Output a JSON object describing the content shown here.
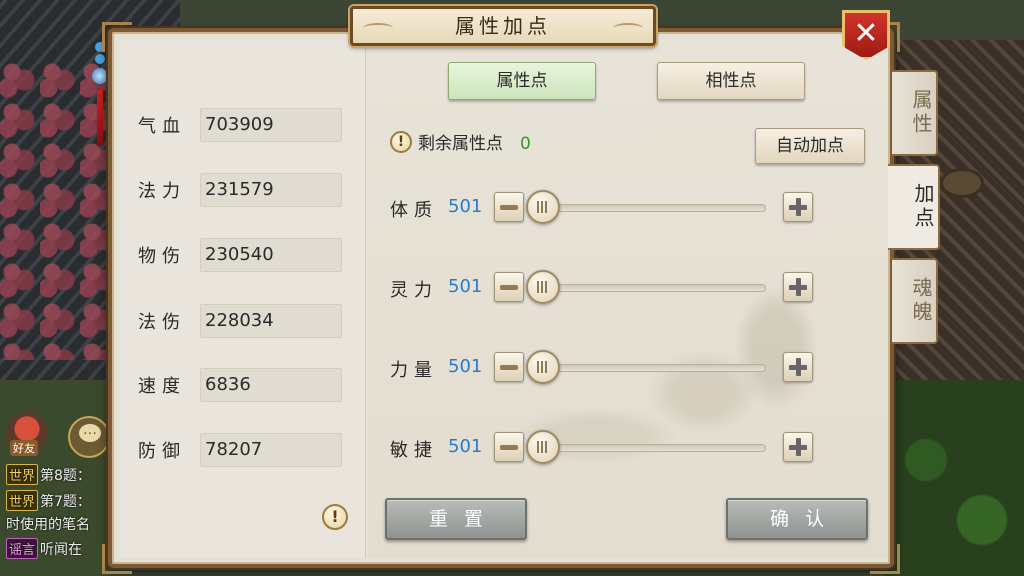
{
  "title": "属性加点",
  "close_symbol": "✕",
  "chat": {
    "friend_label": "好友",
    "lines": [
      {
        "tag": "世界",
        "text": "第8题："
      },
      {
        "tag": "世界",
        "text": "第7题："
      },
      {
        "tag": "",
        "text": "时使用的笔名"
      },
      {
        "tag": "谣言",
        "text": "听闻在"
      }
    ]
  },
  "stats": [
    {
      "label": "气血",
      "value": "703909"
    },
    {
      "label": "法力",
      "value": "231579"
    },
    {
      "label": "物伤",
      "value": "230540"
    },
    {
      "label": "法伤",
      "value": "228034"
    },
    {
      "label": "速度",
      "value": "6836"
    },
    {
      "label": "防御",
      "value": "78207"
    }
  ],
  "info_symbol": "!",
  "tabs": {
    "attribute_points": "属性点",
    "affinity_points": "相性点"
  },
  "remaining": {
    "label": "剩余属性点",
    "value": "0"
  },
  "auto_add": "自动加点",
  "attributes": [
    {
      "name": "体质",
      "value": "501",
      "slider_level": 0
    },
    {
      "name": "灵力",
      "value": "501",
      "slider_level": 0
    },
    {
      "name": "力量",
      "value": "501",
      "slider_level": 0
    },
    {
      "name": "敏捷",
      "value": "501",
      "slider_level": 0
    }
  ],
  "buttons": {
    "reset": "重置",
    "confirm": "确认"
  },
  "side_tabs": [
    "属性",
    "加点",
    "魂魄"
  ]
}
